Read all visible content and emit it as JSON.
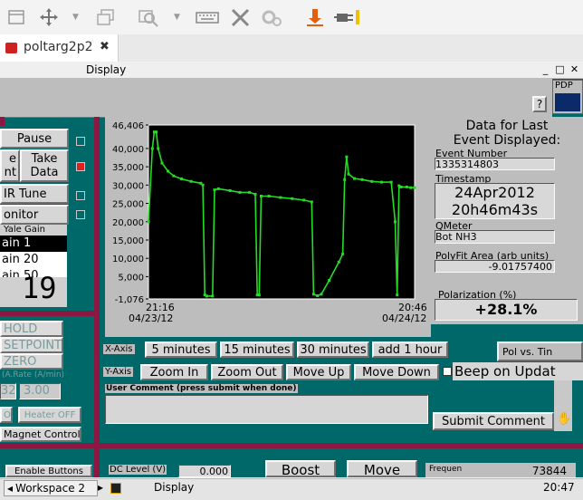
{
  "tab": {
    "title": "poltarg2p2",
    "close": "✖"
  },
  "window": {
    "title": "Display",
    "min": "_",
    "max": "□",
    "close": "✕"
  },
  "corner": {
    "pdp": "PDP",
    "help": "?"
  },
  "left_panel": {
    "pause": "Pause",
    "take_data_a": "Take",
    "take_data_b": "Data",
    "cut_a": "e",
    "cut_b": "nt",
    "nmr_tune": "IR Tune",
    "monitor": "onitor",
    "yale_gain": "Yale Gain",
    "gain_options": [
      "ain 1",
      "ain 20",
      "ain 50"
    ],
    "big_value": "19"
  },
  "magnet": {
    "hold": "HOLD",
    "setpoint": "SETPOINT",
    "zero": "ZERO",
    "rate_label": "(A.Rate (A/min)",
    "rate_current": "32",
    "rate_set": "3.00",
    "on": "ON",
    "heater_off": "Heater OFF",
    "controls": "Magnet Controls"
  },
  "info": {
    "title_a": "Data for Last",
    "title_b": "Event Displayed:",
    "event_number_label": "Event Number",
    "event_number": "1335314803",
    "timestamp_label": "Timestamp",
    "date": "24Apr2012",
    "time": "20h46m43s",
    "qmeter_label": "QMeter",
    "qmeter": "Bot NH3",
    "polyfit_label": "PolyFit Area (arb units)",
    "polyfit": "-9.01757400",
    "polarization_label": "Polarization (%)",
    "polarization": "+28.1%"
  },
  "xaxis": {
    "label": "X-Axis",
    "b1": "5 minutes",
    "b2": "15 minutes",
    "b3": "30 minutes",
    "b4": "add 1 hour"
  },
  "yaxis": {
    "label": "Y-Axis",
    "b1": "Zoom In",
    "b2": "Zoom Out",
    "b3": "Move Up",
    "b4": "Move Down"
  },
  "pol_vs_time": "Pol vs. Tin",
  "beep": "Beep on Updat",
  "comment": {
    "label": "User Comment (press submit when done)",
    "submit": "Submit Comment",
    "value": ""
  },
  "bottom": {
    "enable_buttons": "Enable Buttons",
    "dc_level_label": "DC Level (V)",
    "dc_level": "0.000",
    "boost": "Boost",
    "move": "Move",
    "freq_label": "Frequen",
    "freq_value": "73844"
  },
  "taskbar": {
    "workspace": "Workspace 2",
    "app": "Display",
    "clock": "20:47"
  },
  "colors": {
    "teal": "#006868",
    "trace": "#22dd22",
    "separator": "#8a1840"
  },
  "chart_data": {
    "type": "line",
    "title": "",
    "xlabel": "",
    "ylabel": "",
    "ylim": [
      -1076,
      46406
    ],
    "y_ticks": [
      "46,406",
      "40,000",
      "35,000",
      "30,000",
      "25,000",
      "20,000",
      "15,000",
      "10,000",
      "5,000",
      "-1,076"
    ],
    "x_ticks": [
      {
        "time": "21:16",
        "date": "04/23/12"
      },
      {
        "time": "20:46",
        "date": "04/24/12"
      }
    ],
    "series": [
      {
        "values": [
          [
            0,
            20000
          ],
          [
            2,
            40000
          ],
          [
            3,
            44500
          ],
          [
            4,
            44500
          ],
          [
            5,
            40000
          ],
          [
            7,
            36000
          ],
          [
            10,
            33800
          ],
          [
            13,
            32500
          ],
          [
            17,
            31700
          ],
          [
            22,
            31000
          ],
          [
            27,
            30500
          ],
          [
            28,
            30000
          ],
          [
            29,
            0
          ],
          [
            30,
            -300
          ],
          [
            33,
            -300
          ],
          [
            34,
            28700
          ],
          [
            36,
            29000
          ],
          [
            42,
            28500
          ],
          [
            47,
            28000
          ],
          [
            52,
            28000
          ],
          [
            55,
            27500
          ],
          [
            56,
            0
          ],
          [
            57,
            0
          ],
          [
            58,
            27000
          ],
          [
            62,
            27000
          ],
          [
            68,
            26600
          ],
          [
            74,
            26300
          ],
          [
            80,
            25900
          ],
          [
            84,
            25400
          ],
          [
            85,
            200
          ],
          [
            87,
            -200
          ],
          [
            89,
            200
          ],
          [
            93,
            4000
          ],
          [
            98,
            9000
          ],
          [
            100,
            11200
          ],
          [
            101,
            31500
          ],
          [
            102,
            37700
          ],
          [
            103,
            33000
          ],
          [
            106,
            31800
          ],
          [
            110,
            31500
          ],
          [
            115,
            31000
          ],
          [
            120,
            30800
          ],
          [
            125,
            30800
          ],
          [
            127,
            20000
          ],
          [
            128,
            0
          ],
          [
            129,
            29800
          ],
          [
            130,
            29500
          ],
          [
            133,
            29500
          ],
          [
            135,
            29300
          ],
          [
            137,
            29300
          ]
        ]
      }
    ]
  }
}
